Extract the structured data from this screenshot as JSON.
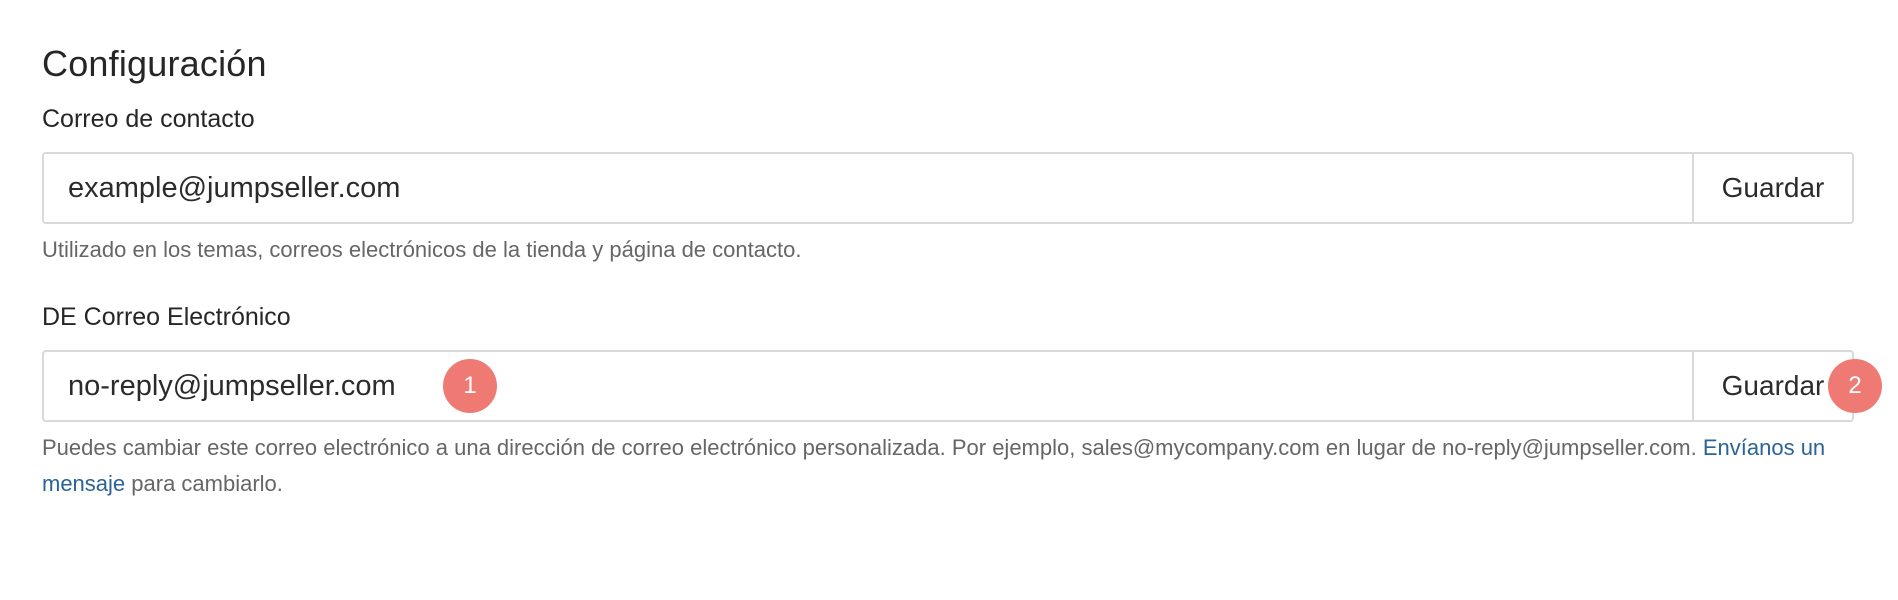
{
  "page": {
    "title": "Configuración"
  },
  "contact_email": {
    "label": "Correo de contacto",
    "value": "example@jumpseller.com",
    "save_label": "Guardar",
    "help_text": "Utilizado en los temas, correos electrónicos de la tienda y página de contacto."
  },
  "from_email": {
    "label": "DE Correo Electrónico",
    "value": "no-reply@jumpseller.com",
    "save_label": "Guardar",
    "help_text_before": "Puedes cambiar este correo electrónico a una dirección de correo electrónico personalizada. Por ejemplo, sales@mycompany.com en lugar de no-reply@jumpseller.com. ",
    "help_link": "Envíanos un mensaje",
    "help_text_after": " para cambiarlo."
  },
  "markers": {
    "one": "1",
    "two": "2"
  },
  "colors": {
    "marker": "#ef7a73",
    "link": "#2a6496",
    "border": "#d9d9d9",
    "help_text": "#666666"
  }
}
